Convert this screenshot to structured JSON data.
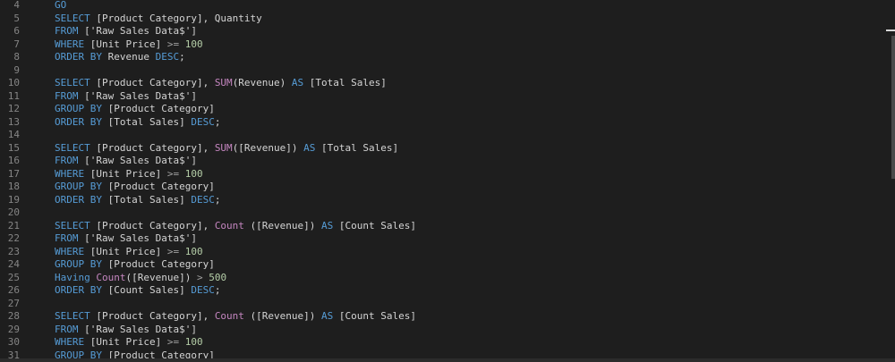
{
  "editor": {
    "lines": [
      {
        "n": "4",
        "tokens": [
          {
            "t": "GO",
            "c": "kw"
          }
        ]
      },
      {
        "n": "5",
        "tokens": [
          {
            "t": "SELECT ",
            "c": "kw"
          },
          {
            "t": "[Product Category], Quantity",
            "c": "br"
          }
        ]
      },
      {
        "n": "6",
        "tokens": [
          {
            "t": "FROM ",
            "c": "kw"
          },
          {
            "t": "['Raw Sales Data$']",
            "c": "br"
          }
        ]
      },
      {
        "n": "7",
        "tokens": [
          {
            "t": "WHERE ",
            "c": "kw"
          },
          {
            "t": "[Unit Price] ",
            "c": "br"
          },
          {
            "t": ">= ",
            "c": "op"
          },
          {
            "t": "100",
            "c": "num"
          }
        ]
      },
      {
        "n": "8",
        "tokens": [
          {
            "t": "ORDER BY ",
            "c": "kw"
          },
          {
            "t": "Revenue ",
            "c": "br"
          },
          {
            "t": "DESC",
            "c": "kw"
          },
          {
            "t": ";",
            "c": "br"
          }
        ]
      },
      {
        "n": "9",
        "tokens": []
      },
      {
        "n": "10",
        "tokens": [
          {
            "t": "SELECT ",
            "c": "kw"
          },
          {
            "t": "[Product Category], ",
            "c": "br"
          },
          {
            "t": "SUM",
            "c": "fn"
          },
          {
            "t": "(Revenue) ",
            "c": "br"
          },
          {
            "t": "AS ",
            "c": "kw"
          },
          {
            "t": "[Total Sales]",
            "c": "br"
          }
        ]
      },
      {
        "n": "11",
        "tokens": [
          {
            "t": "FROM ",
            "c": "kw"
          },
          {
            "t": "['Raw Sales Data$']",
            "c": "br"
          }
        ]
      },
      {
        "n": "12",
        "tokens": [
          {
            "t": "GROUP BY ",
            "c": "kw"
          },
          {
            "t": "[Product Category]",
            "c": "br"
          }
        ]
      },
      {
        "n": "13",
        "tokens": [
          {
            "t": "ORDER BY ",
            "c": "kw"
          },
          {
            "t": "[Total Sales] ",
            "c": "br"
          },
          {
            "t": "DESC",
            "c": "kw"
          },
          {
            "t": ";",
            "c": "br"
          }
        ]
      },
      {
        "n": "14",
        "tokens": []
      },
      {
        "n": "15",
        "tokens": [
          {
            "t": "SELECT ",
            "c": "kw"
          },
          {
            "t": "[Product Category], ",
            "c": "br"
          },
          {
            "t": "SUM",
            "c": "fn"
          },
          {
            "t": "([Revenue]) ",
            "c": "br"
          },
          {
            "t": "AS ",
            "c": "kw"
          },
          {
            "t": "[Total Sales]",
            "c": "br"
          }
        ]
      },
      {
        "n": "16",
        "tokens": [
          {
            "t": "FROM ",
            "c": "kw"
          },
          {
            "t": "['Raw Sales Data$']",
            "c": "br"
          }
        ]
      },
      {
        "n": "17",
        "tokens": [
          {
            "t": "WHERE ",
            "c": "kw"
          },
          {
            "t": "[Unit Price] ",
            "c": "br"
          },
          {
            "t": ">= ",
            "c": "op"
          },
          {
            "t": "100",
            "c": "num"
          }
        ]
      },
      {
        "n": "18",
        "tokens": [
          {
            "t": "GROUP BY ",
            "c": "kw"
          },
          {
            "t": "[Product Category]",
            "c": "br"
          }
        ]
      },
      {
        "n": "19",
        "tokens": [
          {
            "t": "ORDER BY ",
            "c": "kw"
          },
          {
            "t": "[Total Sales] ",
            "c": "br"
          },
          {
            "t": "DESC",
            "c": "kw"
          },
          {
            "t": ";",
            "c": "br"
          }
        ]
      },
      {
        "n": "20",
        "tokens": []
      },
      {
        "n": "21",
        "tokens": [
          {
            "t": "SELECT ",
            "c": "kw"
          },
          {
            "t": "[Product Category], ",
            "c": "br"
          },
          {
            "t": "Count ",
            "c": "fn"
          },
          {
            "t": "([Revenue]) ",
            "c": "br"
          },
          {
            "t": "AS ",
            "c": "kw"
          },
          {
            "t": "[Count Sales]",
            "c": "br"
          }
        ]
      },
      {
        "n": "22",
        "tokens": [
          {
            "t": "FROM ",
            "c": "kw"
          },
          {
            "t": "['Raw Sales Data$']",
            "c": "br"
          }
        ]
      },
      {
        "n": "23",
        "tokens": [
          {
            "t": "WHERE ",
            "c": "kw"
          },
          {
            "t": "[Unit Price] ",
            "c": "br"
          },
          {
            "t": ">= ",
            "c": "op"
          },
          {
            "t": "100",
            "c": "num"
          }
        ]
      },
      {
        "n": "24",
        "tokens": [
          {
            "t": "GROUP BY ",
            "c": "kw"
          },
          {
            "t": "[Product Category]",
            "c": "br"
          }
        ]
      },
      {
        "n": "25",
        "tokens": [
          {
            "t": "Having ",
            "c": "kw"
          },
          {
            "t": "Count",
            "c": "fn"
          },
          {
            "t": "([Revenue]) ",
            "c": "br"
          },
          {
            "t": "> ",
            "c": "op"
          },
          {
            "t": "500",
            "c": "num"
          }
        ]
      },
      {
        "n": "26",
        "tokens": [
          {
            "t": "ORDER BY ",
            "c": "kw"
          },
          {
            "t": "[Count Sales] ",
            "c": "br"
          },
          {
            "t": "DESC",
            "c": "kw"
          },
          {
            "t": ";",
            "c": "br"
          }
        ]
      },
      {
        "n": "27",
        "tokens": []
      },
      {
        "n": "28",
        "tokens": [
          {
            "t": "SELECT ",
            "c": "kw"
          },
          {
            "t": "[Product Category], ",
            "c": "br"
          },
          {
            "t": "Count ",
            "c": "fn"
          },
          {
            "t": "([Revenue]) ",
            "c": "br"
          },
          {
            "t": "AS ",
            "c": "kw"
          },
          {
            "t": "[Count Sales]",
            "c": "br"
          }
        ]
      },
      {
        "n": "29",
        "tokens": [
          {
            "t": "FROM ",
            "c": "kw"
          },
          {
            "t": "['Raw Sales Data$']",
            "c": "br"
          }
        ]
      },
      {
        "n": "30",
        "tokens": [
          {
            "t": "WHERE ",
            "c": "kw"
          },
          {
            "t": "[Unit Price] ",
            "c": "br"
          },
          {
            "t": ">= ",
            "c": "op"
          },
          {
            "t": "100",
            "c": "num"
          }
        ]
      },
      {
        "n": "31",
        "tokens": [
          {
            "t": "GROUP BY ",
            "c": "kw"
          },
          {
            "t": "[Product Category]",
            "c": "br"
          }
        ]
      }
    ]
  },
  "colors": {
    "background": "#1e1e1e",
    "keyword": "#569cd6",
    "function": "#c586c0",
    "number": "#b5cea8",
    "text": "#d4d4d4",
    "line_number": "#858585"
  }
}
